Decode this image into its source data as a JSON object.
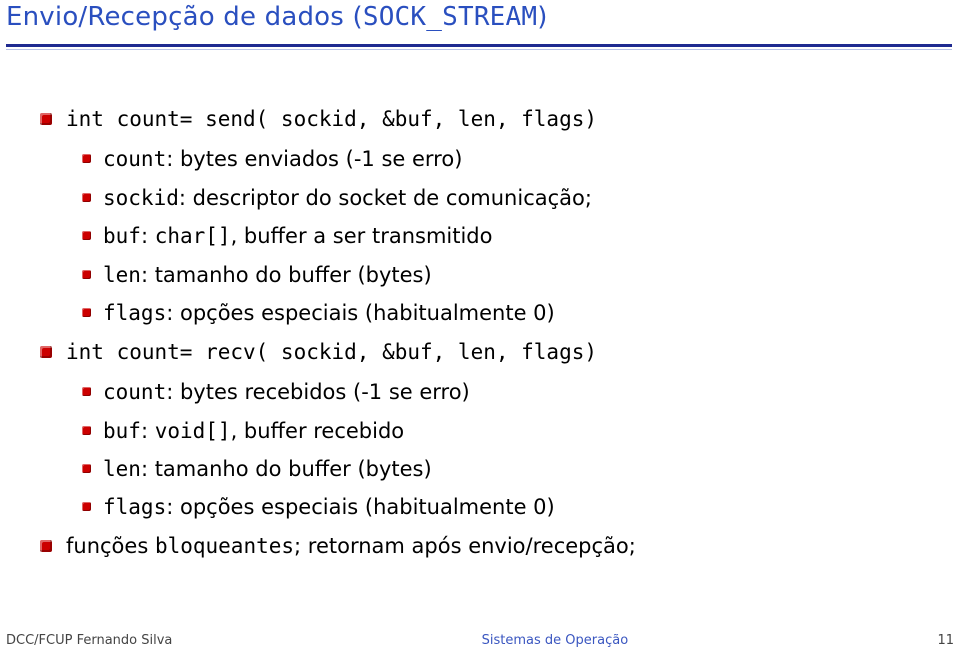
{
  "title": {
    "prefix": "Envio/Recepção de dados (",
    "code": "SOCK_STREAM",
    "suffix": ")"
  },
  "items": [
    {
      "type": "code",
      "text": "int count= send( sockid, &buf, len, flags)",
      "children": [
        {
          "code": "count",
          "rest": ": bytes enviados (-1 se erro)"
        },
        {
          "code": "sockid",
          "rest": ": descriptor do socket de comunicação;"
        },
        {
          "code": "buf",
          "rest_a": ": ",
          "code2": "char[]",
          "rest_b": ", buffer a ser transmitido"
        },
        {
          "code": "len",
          "rest": ": tamanho do buffer (bytes)"
        },
        {
          "code": "flags",
          "rest": ": opções especiais (habitualmente 0)"
        }
      ]
    },
    {
      "type": "code",
      "text": "int count= recv( sockid, &buf, len, flags)",
      "children": [
        {
          "code": "count",
          "rest": ":  bytes recebidos (-1 se erro)"
        },
        {
          "code": "buf",
          "rest_a": ": ",
          "code2": "void[]",
          "rest_b": ", buffer recebido"
        },
        {
          "code": "len",
          "rest": ": tamanho do buffer (bytes)"
        },
        {
          "code": "flags",
          "rest": ": opções especiais (habitualmente 0)"
        }
      ]
    },
    {
      "type": "mixed",
      "pre": "funções ",
      "code": "bloqueantes",
      "post": "; retornam após envio/recepção;"
    }
  ],
  "footer": {
    "left": "DCC/FCUP Fernando Silva",
    "center": "Sistemas de Operação",
    "right": "11"
  }
}
